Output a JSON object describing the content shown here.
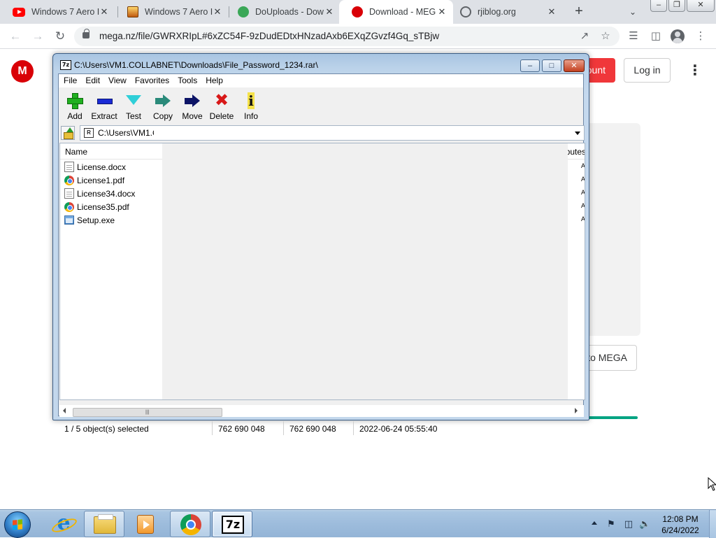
{
  "browser": {
    "tabs": [
      {
        "title": "Windows 7 Aero I",
        "icon": "youtube-icon",
        "active": false
      },
      {
        "title": "Windows 7 Aero I",
        "icon": "windows7-themes-icon",
        "active": false
      },
      {
        "title": "DoUploads - Dow",
        "icon": "douploads-icon",
        "active": false
      },
      {
        "title": "Download - MEG",
        "icon": "mega-icon",
        "active": true
      },
      {
        "title": "rjiblog.org",
        "icon": "globe-icon",
        "active": false
      }
    ],
    "new_tab_label": "+",
    "tab_close_glyph": "✕",
    "url": "mega.nz/file/GWRXRIpL#6xZC54F-9zDudEDtxHNzadAxb6EXqZGvzf4Gq_sTBjw"
  },
  "mega": {
    "logo_letter": "M",
    "create_account_fragment": "ount",
    "login_label": "Log in",
    "cta_fragment": "to MEGA",
    "accent_color": "#d90007",
    "progress_color": "#00a382"
  },
  "sevenzip": {
    "title": "C:\\Users\\VM1.COLLABNET\\Downloads\\File_Password_1234.rar\\",
    "app_icon_text": "7z",
    "menu": [
      "File",
      "Edit",
      "View",
      "Favorites",
      "Tools",
      "Help"
    ],
    "toolbar": [
      {
        "label": "Add",
        "icon": "add-icon"
      },
      {
        "label": "Extract",
        "icon": "extract-icon"
      },
      {
        "label": "Test",
        "icon": "test-icon"
      },
      {
        "label": "Copy",
        "icon": "copy-icon"
      },
      {
        "label": "Move",
        "icon": "move-icon"
      },
      {
        "label": "Delete",
        "icon": "delete-icon"
      },
      {
        "label": "Info",
        "icon": "info-icon"
      }
    ],
    "path": "C:\\Users\\VM1.C",
    "columns": {
      "name": "Name",
      "attributes": "ributes"
    },
    "files": [
      {
        "name": "License.docx",
        "icon": "document-icon",
        "attr": "A"
      },
      {
        "name": "License1.pdf",
        "icon": "chrome-pdf-icon",
        "attr": "A"
      },
      {
        "name": "License34.docx",
        "icon": "document-icon",
        "attr": "A"
      },
      {
        "name": "License35.pdf",
        "icon": "chrome-pdf-icon",
        "attr": "A"
      },
      {
        "name": "Setup.exe",
        "icon": "executable-icon",
        "attr": "A"
      }
    ],
    "status": {
      "selection": "1 / 5 object(s) selected",
      "size": "762 690 048",
      "packed": "762 690 048",
      "modified": "2022-06-24 05:55:40"
    }
  },
  "taskbar": {
    "apps": [
      "Internet Explorer",
      "Windows Explorer",
      "Windows Media Player",
      "Google Chrome",
      "7-Zip"
    ],
    "clock_time": "12:08 PM",
    "clock_date": "6/24/2022"
  }
}
